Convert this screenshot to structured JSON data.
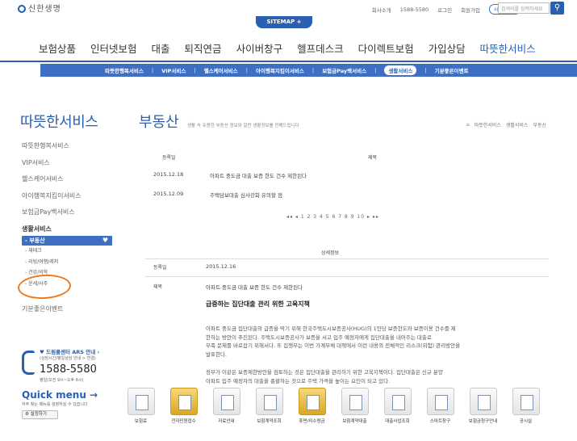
{
  "header": {
    "logo_text": "신한생명",
    "util_links": [
      "회사소개",
      "1588-5580",
      "로그인",
      "회원가입"
    ],
    "lang_select": "사이트맵 ▾",
    "search_placeholder": "검색어를 입력하세요",
    "sitemap_tab": "SITEMAP +"
  },
  "gnb": [
    "보험상품",
    "인터넷보험",
    "대출",
    "퇴직연금",
    "사이버창구",
    "헬프데스크",
    "다이렉트보험",
    "가입상담",
    "따뜻한서비스"
  ],
  "subnav": [
    "따뜻한행복서비스",
    "VIP서비스",
    "헬스케어서비스",
    "아이행복지킴이서비스",
    "보험금Pay백서비스",
    "생활서비스",
    "기분좋은이벤트"
  ],
  "side": {
    "title": "따뜻한서비스",
    "menu": [
      "따뜻한행복서비스",
      "VIP서비스",
      "헬스케어서비스",
      "아이행복지킴이서비스",
      "보험금Pay백서비스",
      "생활서비스"
    ],
    "sub_active": "- 부동산",
    "sub_items": [
      "- 재테크",
      "- 리빙/여행/레저",
      "- 건강/의학",
      "- 운세/사주"
    ],
    "event": "기분좋은이벤트"
  },
  "page": {
    "title": "부동산",
    "desc": "생활 속 유용한 부동산 정보와 알찬 생활정보를 전해드립니다",
    "breadcrumb": [
      "⌂",
      "따뜻한서비스",
      "생활서비스",
      "부동산"
    ]
  },
  "list": {
    "head_date": "등록일",
    "head_title": "제목",
    "rows": [
      {
        "date": "2015.12.18",
        "title": "아파트 중도금 대출 보증 한도 건수 제한된다"
      },
      {
        "date": "2015.12.09",
        "title": "주택담보대출 심사강화 유의할 점"
      }
    ],
    "pager": "◂◂ ◂ 1 2 3 4 5 6 7 8 9 10 ▸ ▸▸"
  },
  "detail": {
    "heading": "상세정보",
    "date_label": "등록일",
    "date_value": "2015.12.16",
    "title_label": "제목",
    "title_value": "아파트 중도금 대출 보증 한도 건수 제한된다",
    "headline": "급증하는 집단대출 관리 위한 고육지책",
    "para1": [
      "아파트 중도금 집단대출의 급증을 막기 위해 한국주택도시보증공사(HUG)의 1인당 보증한도와 보증이용 건수를 제",
      "한하는 방안이 추진된다. 주택도시보증공사가 보증을 서고 입주 예정자에게 집단대출을 내어주는 대출로",
      "부족 문제를 바로잡기 위해서다. 또 집행부는 이번 가계부채 대책에서 이런 내용의 전체적인 리스크(위험) 관리방안을",
      "발표한다."
    ],
    "para2": [
      "정부가 이같은 보증제한방안을 검토하는 것은 집단대출을 관리하기 위한 고육지책이다. 집단대출은 신규 분양",
      "아파트 입주 예정자의 대출을 총괄하는 것으로 주택 가격을 높이는 요인이 되고 있다."
    ]
  },
  "callcenter": {
    "title": "♥ 드림콜센터",
    "title_sub": "ARS 안내 ›",
    "desc": "(상담시간/평일상담 안내 > 연결)",
    "number": "1588-5580",
    "hours": "평일(오전 9시~오후 6시)"
  },
  "quick": {
    "title": "Quick menu →",
    "desc": "자주 찾는 메뉴를 설정하실 수 있습니다",
    "setting": "⚙ 설정하기"
  },
  "quick_items": [
    "보험료",
    "전자민원접수",
    "자료안내",
    "보험계약조회",
    "휴면/미수령금",
    "보험계약대출",
    "대출사업조회",
    "스마트창구",
    "보험금청구안내",
    "공시실"
  ]
}
